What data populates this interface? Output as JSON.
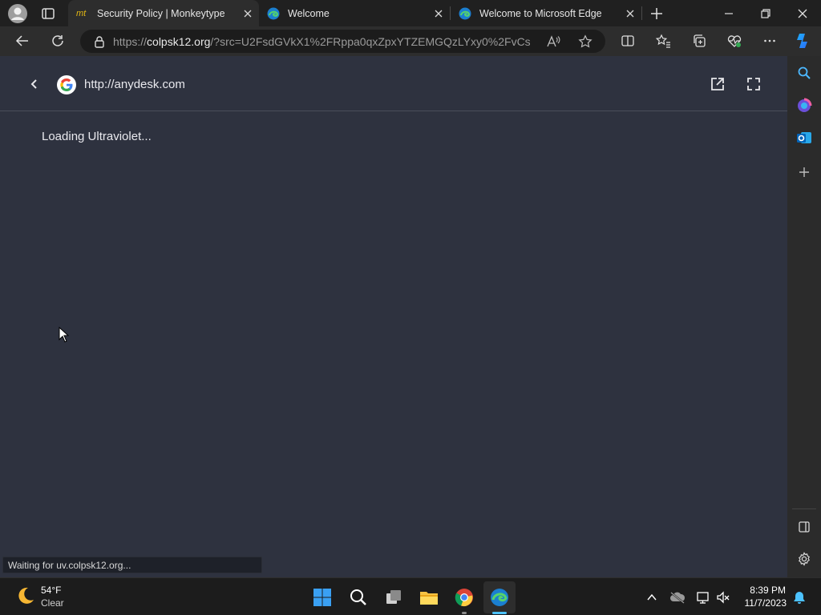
{
  "browser": {
    "tabs": [
      {
        "title": "Security Policy | Monkeytype",
        "favicon": "mt"
      },
      {
        "title": "Welcome"
      },
      {
        "title": "Welcome to Microsoft Edge"
      }
    ],
    "address": {
      "url_prefix": "https://",
      "url_domain": "colpsk12.org",
      "url_rest": "/?src=U2FsdGVkX1%2FRppa0qxZpxYTZEMGQzLYxy0%2FvCs9x..."
    }
  },
  "page": {
    "site_address": "http://anydesk.com",
    "loading_text": "Loading Ultraviolet...",
    "status_text": "Waiting for uv.colpsk12.org..."
  },
  "taskbar": {
    "weather": {
      "temp": "54°F",
      "condition": "Clear"
    },
    "clock": {
      "time": "8:39 PM",
      "date": "11/7/2023"
    }
  },
  "colors": {
    "content_bg": "#2e323f",
    "edge_accent": "#33a9e8"
  }
}
